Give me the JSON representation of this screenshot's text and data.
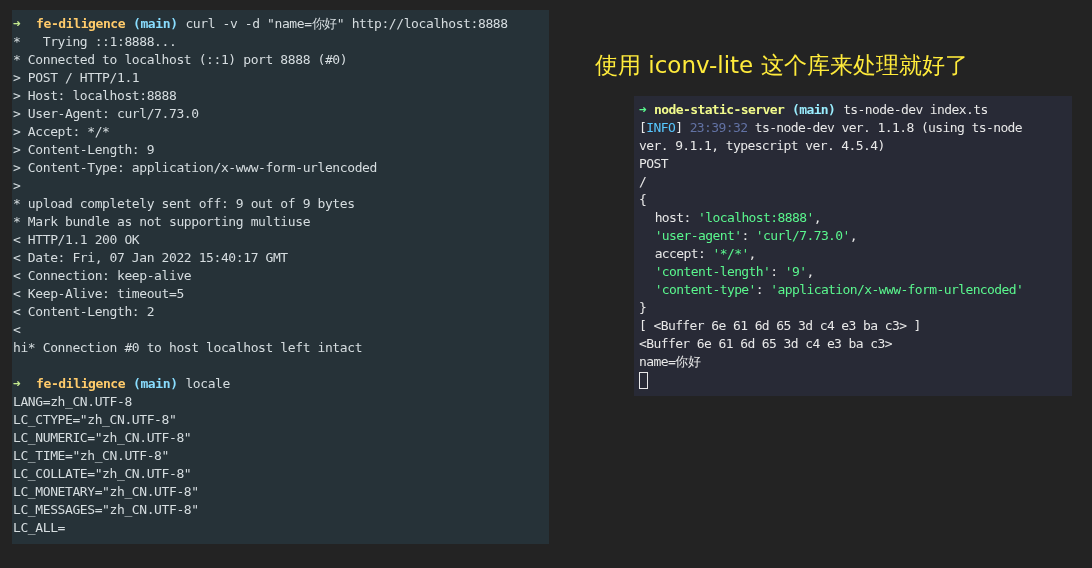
{
  "left_terminal": {
    "lines": [
      [
        {
          "kind": "arrow",
          "text": "➜"
        },
        {
          "kind": "dir",
          "text": "fe-diligence"
        },
        {
          "kind": "branch",
          "text": "(main)"
        },
        {
          "kind": "plain",
          "text": "curl -v -d \"name=你好\" http://localhost:8888"
        }
      ],
      [
        {
          "kind": "plain",
          "text": "*   Trying ::1:8888..."
        }
      ],
      [
        {
          "kind": "plain",
          "text": "* Connected to localhost (::1) port 8888 (#0)"
        }
      ],
      [
        {
          "kind": "plain",
          "text": "> POST / HTTP/1.1"
        }
      ],
      [
        {
          "kind": "plain",
          "text": "> Host: localhost:8888"
        }
      ],
      [
        {
          "kind": "plain",
          "text": "> User-Agent: curl/7.73.0"
        }
      ],
      [
        {
          "kind": "plain",
          "text": "> Accept: */*"
        }
      ],
      [
        {
          "kind": "plain",
          "text": "> Content-Length: 9"
        }
      ],
      [
        {
          "kind": "plain",
          "text": "> Content-Type: application/x-www-form-urlencoded"
        }
      ],
      [
        {
          "kind": "plain",
          "text": ">"
        }
      ],
      [
        {
          "kind": "plain",
          "text": "* upload completely sent off: 9 out of 9 bytes"
        }
      ],
      [
        {
          "kind": "plain",
          "text": "* Mark bundle as not supporting multiuse"
        }
      ],
      [
        {
          "kind": "plain",
          "text": "< HTTP/1.1 200 OK"
        }
      ],
      [
        {
          "kind": "plain",
          "text": "< Date: Fri, 07 Jan 2022 15:40:17 GMT"
        }
      ],
      [
        {
          "kind": "plain",
          "text": "< Connection: keep-alive"
        }
      ],
      [
        {
          "kind": "plain",
          "text": "< Keep-Alive: timeout=5"
        }
      ],
      [
        {
          "kind": "plain",
          "text": "< Content-Length: 2"
        }
      ],
      [
        {
          "kind": "plain",
          "text": "<"
        }
      ],
      [
        {
          "kind": "plain",
          "text": "hi* Connection #0 to host localhost left intact"
        }
      ],
      [
        {
          "kind": "blank"
        }
      ],
      [
        {
          "kind": "arrow",
          "text": "➜"
        },
        {
          "kind": "dir",
          "text": "fe-diligence"
        },
        {
          "kind": "branch",
          "text": "(main)"
        },
        {
          "kind": "plain",
          "text": "locale"
        }
      ],
      [
        {
          "kind": "plain",
          "text": "LANG=zh_CN.UTF-8"
        }
      ],
      [
        {
          "kind": "plain",
          "text": "LC_CTYPE=\"zh_CN.UTF-8\""
        }
      ],
      [
        {
          "kind": "plain",
          "text": "LC_NUMERIC=\"zh_CN.UTF-8\""
        }
      ],
      [
        {
          "kind": "plain",
          "text": "LC_TIME=\"zh_CN.UTF-8\""
        }
      ],
      [
        {
          "kind": "plain",
          "text": "LC_COLLATE=\"zh_CN.UTF-8\""
        }
      ],
      [
        {
          "kind": "plain",
          "text": "LC_MONETARY=\"zh_CN.UTF-8\""
        }
      ],
      [
        {
          "kind": "plain",
          "text": "LC_MESSAGES=\"zh_CN.UTF-8\""
        }
      ],
      [
        {
          "kind": "plain",
          "text": "LC_ALL="
        }
      ]
    ]
  },
  "caption": "使用 iconv-lite 这个库来处理就好了",
  "right_terminal": {
    "lines": [
      [
        {
          "kind": "arrow",
          "text": "➜"
        },
        {
          "kind": "dir",
          "text": "node-static-server"
        },
        {
          "kind": "branch",
          "text": "(main)"
        },
        {
          "kind": "plain",
          "text": "ts-node-dev index.ts"
        }
      ],
      [
        {
          "kind": "plain",
          "text": "["
        },
        {
          "kind": "info",
          "text": "INFO"
        },
        {
          "kind": "plain",
          "text": "] "
        },
        {
          "kind": "time",
          "text": "23:39:32"
        },
        {
          "kind": "plain",
          "text": " ts-node-dev ver. 1.1.8 (using ts-node"
        }
      ],
      [
        {
          "kind": "plain",
          "text": "ver. 9.1.1, typescript ver. 4.5.4)"
        }
      ],
      [
        {
          "kind": "plain",
          "text": "POST"
        }
      ],
      [
        {
          "kind": "plain",
          "text": "/"
        }
      ],
      [
        {
          "kind": "plain",
          "text": "{"
        }
      ],
      [
        {
          "kind": "indent"
        },
        {
          "kind": "plain",
          "text": "host: "
        },
        {
          "kind": "string",
          "text": "'localhost:8888'"
        },
        {
          "kind": "plain",
          "text": ","
        }
      ],
      [
        {
          "kind": "indent"
        },
        {
          "kind": "string",
          "text": "'user-agent'"
        },
        {
          "kind": "plain",
          "text": ": "
        },
        {
          "kind": "string",
          "text": "'curl/7.73.0'"
        },
        {
          "kind": "plain",
          "text": ","
        }
      ],
      [
        {
          "kind": "indent"
        },
        {
          "kind": "plain",
          "text": "accept: "
        },
        {
          "kind": "string",
          "text": "'*/*'"
        },
        {
          "kind": "plain",
          "text": ","
        }
      ],
      [
        {
          "kind": "indent"
        },
        {
          "kind": "string",
          "text": "'content-length'"
        },
        {
          "kind": "plain",
          "text": ": "
        },
        {
          "kind": "string",
          "text": "'9'"
        },
        {
          "kind": "plain",
          "text": ","
        }
      ],
      [
        {
          "kind": "indent"
        },
        {
          "kind": "string",
          "text": "'content-type'"
        },
        {
          "kind": "plain",
          "text": ": "
        },
        {
          "kind": "string",
          "text": "'application/x-www-form-urlencoded'"
        }
      ],
      [
        {
          "kind": "plain",
          "text": "}"
        }
      ],
      [
        {
          "kind": "plain",
          "text": "[ <Buffer 6e 61 6d 65 3d c4 e3 ba c3> ]"
        }
      ],
      [
        {
          "kind": "plain",
          "text": "<Buffer 6e 61 6d 65 3d c4 e3 ba c3>"
        }
      ],
      [
        {
          "kind": "plain",
          "text": "name=你好"
        }
      ],
      [
        {
          "kind": "cursor"
        }
      ]
    ]
  }
}
